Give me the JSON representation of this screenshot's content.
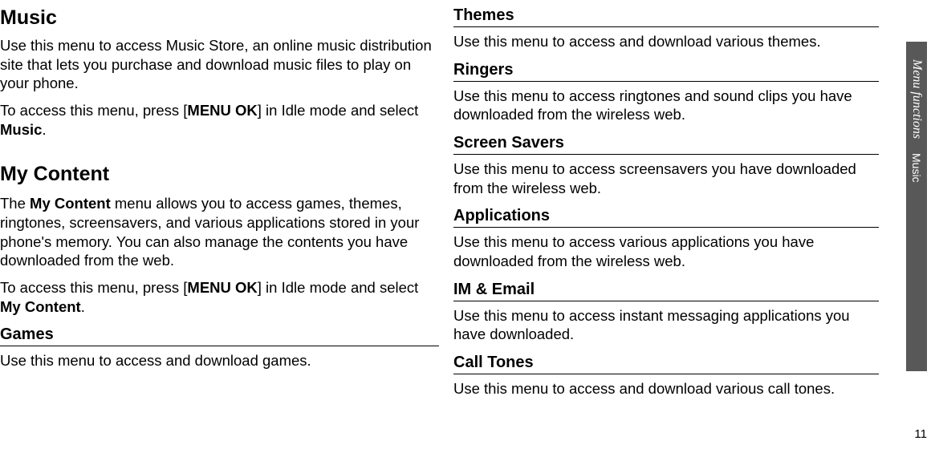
{
  "left": {
    "music": {
      "heading": "Music",
      "p1_a": "Use this menu to access Music Store, an online music distribution site that lets you purchase and download music files to play on your phone.",
      "p2_a": "To access this menu, press [",
      "p2_b": "MENU OK",
      "p2_c": "] in Idle mode and select ",
      "p2_d": "Music",
      "p2_e": "."
    },
    "mycontent": {
      "heading": "My Content",
      "p1_a": "The ",
      "p1_b": "My Content",
      "p1_c": " menu allows you to access games, themes, ringtones, screensavers, and various applications stored in your phone's memory. You can also manage the contents you have downloaded from the web.",
      "p2_a": "To access this menu, press [",
      "p2_b": "MENU OK",
      "p2_c": "] in Idle mode and select ",
      "p2_d": "My Content",
      "p2_e": "."
    },
    "games": {
      "heading": "Games",
      "p1": "Use this menu to access and download games."
    }
  },
  "right": {
    "themes": {
      "heading": "Themes",
      "p1": "Use this menu to access and download various themes."
    },
    "ringers": {
      "heading": "Ringers",
      "p1": "Use this menu to access ringtones and sound clips you have downloaded from the wireless web."
    },
    "screensavers": {
      "heading": "Screen Savers",
      "p1": "Use this menu to access screensavers you have downloaded from the wireless web."
    },
    "applications": {
      "heading": "Applications",
      "p1": "Use this menu to access various applications you have downloaded from the wireless web."
    },
    "imemail": {
      "heading": "IM & Email",
      "p1": "Use this menu to access instant messaging applications you have downloaded."
    },
    "calltones": {
      "heading": "Call Tones",
      "p1": "Use this menu to access and download various call tones."
    }
  },
  "sidebar": {
    "italic": "Menu functions",
    "section": "Music"
  },
  "page_number": "11"
}
